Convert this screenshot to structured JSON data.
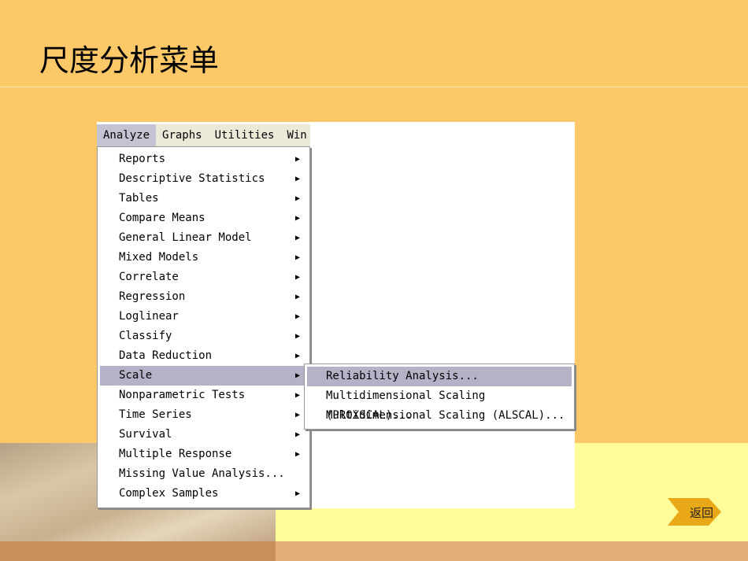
{
  "title": "尺度分析菜单",
  "menubar": [
    "Analyze",
    "Graphs",
    "Utilities",
    "Win"
  ],
  "analyze_menu": [
    {
      "label": "Reports",
      "submenu": true
    },
    {
      "label": "Descriptive Statistics",
      "submenu": true
    },
    {
      "label": "Tables",
      "submenu": true
    },
    {
      "label": "Compare Means",
      "submenu": true
    },
    {
      "label": "General Linear Model",
      "submenu": true
    },
    {
      "label": "Mixed Models",
      "submenu": true
    },
    {
      "label": "Correlate",
      "submenu": true
    },
    {
      "label": "Regression",
      "submenu": true
    },
    {
      "label": "Loglinear",
      "submenu": true
    },
    {
      "label": "Classify",
      "submenu": true
    },
    {
      "label": "Data Reduction",
      "submenu": true
    },
    {
      "label": "Scale",
      "submenu": true,
      "selected": true
    },
    {
      "label": "Nonparametric Tests",
      "submenu": true
    },
    {
      "label": "Time Series",
      "submenu": true
    },
    {
      "label": "Survival",
      "submenu": true
    },
    {
      "label": "Multiple Response",
      "submenu": true
    },
    {
      "label": "Missing Value Analysis...",
      "submenu": false
    },
    {
      "label": "Complex Samples",
      "submenu": true
    }
  ],
  "scale_submenu": [
    "Reliability Analysis...",
    "Multidimensional Scaling (PROXSCAL)...",
    "Multidimensional Scaling (ALSCAL)..."
  ],
  "back_label": "返回"
}
